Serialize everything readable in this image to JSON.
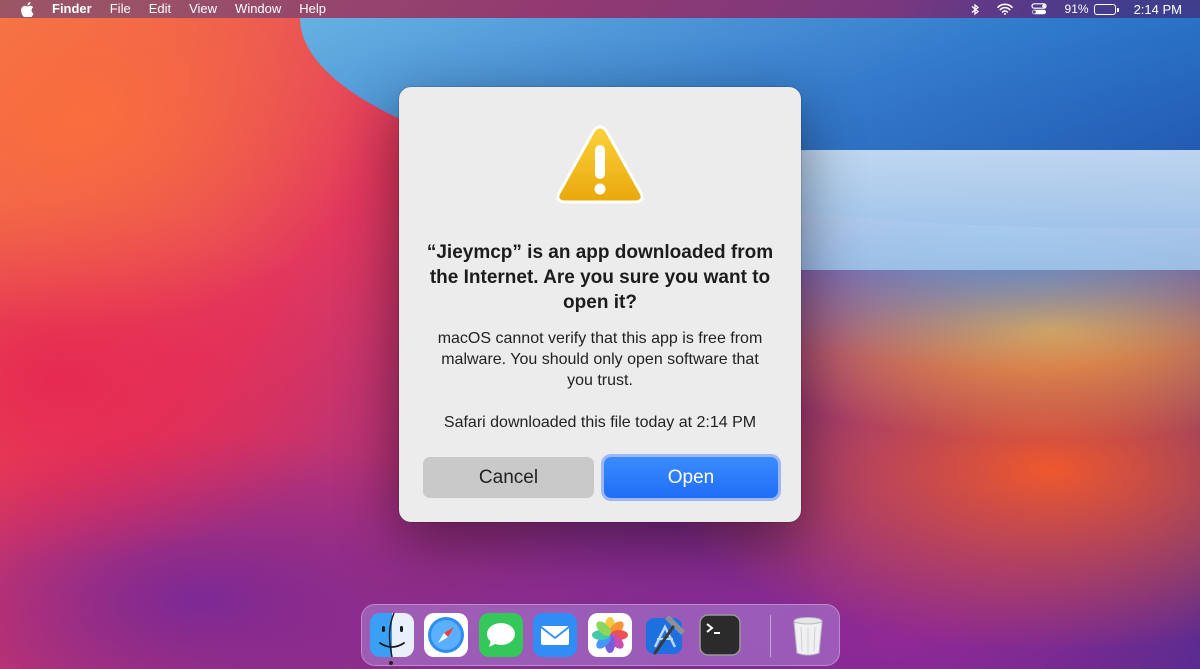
{
  "menubar": {
    "apple_icon": "apple-logo-icon",
    "app_name": "Finder",
    "menus": [
      "File",
      "Edit",
      "View",
      "Window",
      "Help"
    ],
    "status": {
      "bluetooth_icon": "bluetooth-icon",
      "wifi_icon": "wifi-icon",
      "control_center_icon": "control-center-icon",
      "battery_percent": "91%",
      "battery_level": 0.91,
      "clock": "2:14 PM"
    }
  },
  "dialog": {
    "icon": "warning-triangle-icon",
    "title": "“Jieymcp” is an app downloaded from the Internet. Are you sure you want to open it?",
    "message": "macOS cannot verify that this app is free from malware. You should only open software that you trust.",
    "source": "Safari downloaded this file today at 2:14 PM",
    "cancel_label": "Cancel",
    "open_label": "Open",
    "accent_color": "#1f6ef5"
  },
  "dock": {
    "items": [
      {
        "name": "finder",
        "icon": "finder-icon",
        "running": true
      },
      {
        "name": "safari",
        "icon": "safari-icon",
        "running": false
      },
      {
        "name": "messages",
        "icon": "messages-icon",
        "running": false
      },
      {
        "name": "mail",
        "icon": "mail-icon",
        "running": false
      },
      {
        "name": "photos",
        "icon": "photos-icon",
        "running": false
      },
      {
        "name": "xcode",
        "icon": "xcode-icon",
        "running": false
      },
      {
        "name": "terminal",
        "icon": "terminal-icon",
        "running": false
      },
      {
        "name": "trash",
        "icon": "trash-icon",
        "running": false
      }
    ]
  }
}
